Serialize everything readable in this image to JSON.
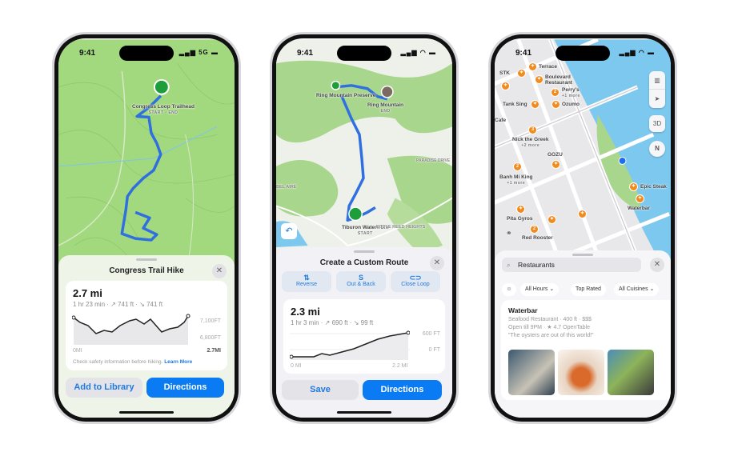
{
  "status": {
    "time": "9:41",
    "network": "5G"
  },
  "phone1": {
    "map": {
      "trailhead_name": "Congress Loop Trailhead",
      "trailhead_tag": "START · END"
    },
    "sheet": {
      "title": "Congress Trail Hike",
      "close_icon": "xmark",
      "distance": "2.7 mi",
      "meta": "1 hr 23 min · ↗ 741 ft · ↘ 741 ft",
      "elev_high": "7,100FT",
      "elev_low": "6,800FT",
      "x_start": "0MI",
      "x_end": "2.7MI",
      "safety_text": "Check safety information before hiking.",
      "learn_more": "Learn More",
      "add_library": "Add to Library",
      "directions": "Directions"
    }
  },
  "phone2": {
    "map": {
      "preserve": "Ring Mountain Preserve",
      "mountain": "Ring Mountain",
      "end_tag": "END",
      "waterfront": "Tiburon Waterfront",
      "start_tag": "START",
      "area1": "PARADISE DRIVE",
      "area2": "LITTLE REED HEIGHTS",
      "area3": "BEL AIRE"
    },
    "sheet": {
      "title": "Create a Custom Route",
      "options": [
        {
          "icon": "⇅",
          "label": "Reverse"
        },
        {
          "icon": "S",
          "label": "Out & Back"
        },
        {
          "icon": "⊂⊃",
          "label": "Close Loop"
        }
      ],
      "distance": "2.3 mi",
      "meta": "1 hr 3 min · ↗ 690 ft · ↘ 99 ft",
      "elev_high": "600 FT",
      "elev_low": "0 FT",
      "x_start": "0 MI",
      "x_end": "2.2 MI",
      "save": "Save",
      "directions": "Directions"
    }
  },
  "phone3": {
    "map": {
      "places": [
        "Terrace",
        "STK",
        "Boulevard Restaurant",
        "Perry's",
        "+1 more",
        "Ozumo",
        "Tank Sing",
        "Cafe",
        "Nick the Greek",
        "+2 more",
        "GOZU",
        "Banh Mi King",
        "+1 more",
        "Epic Steak",
        "Waterbar",
        "Pita Gyros",
        "Red Rooster"
      ],
      "btn_3d": "3D",
      "compass": "N"
    },
    "sheet": {
      "search_value": "Restaurants",
      "filters": [
        "All Hours ⌄",
        "Top Rated",
        "All Cuisines ⌄"
      ],
      "result": {
        "name": "Waterbar",
        "line1": "Seafood Restaurant · 400 ft · $$$",
        "line2": "Open till 9PM · ★ 4.7 OpenTable",
        "quote": "\"The oysters are out of this world!\""
      }
    }
  },
  "colors": {
    "accent": "#0a7bf2",
    "route": "#2f6fe0",
    "trail_green": "#9bd873",
    "poi_orange": "#f28b1e",
    "water": "#7cc8ee"
  }
}
